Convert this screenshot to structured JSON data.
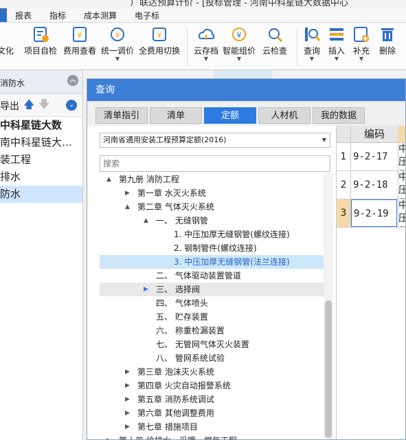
{
  "window": {
    "title": "广联达预算计价 - [投标管理 - 河南中科星链大数据中心"
  },
  "menu": {
    "items": [
      "报表",
      "指标",
      "成本测算",
      "电子标"
    ]
  },
  "ribbon": {
    "partial_label": "文化",
    "buttons": [
      {
        "label": "项目自检",
        "icon": "project-check-icon",
        "dropdown": false
      },
      {
        "label": "费用查看",
        "icon": "fee-view-icon",
        "dropdown": false
      },
      {
        "label": "统一调价",
        "icon": "unified-price-icon",
        "dropdown": true
      },
      {
        "label": "全费用切换",
        "icon": "full-fee-switch-icon",
        "dropdown": false
      },
      {
        "label": "云存档",
        "icon": "cloud-archive-icon",
        "dropdown": true
      },
      {
        "label": "智能组价",
        "icon": "smart-pricing-icon",
        "dropdown": true
      },
      {
        "label": "云检查",
        "icon": "cloud-check-icon",
        "dropdown": false
      },
      {
        "label": "查询",
        "icon": "query-icon",
        "dropdown": true
      },
      {
        "label": "插入",
        "icon": "insert-icon",
        "dropdown": true
      },
      {
        "label": "补充",
        "icon": "supplement-icon",
        "dropdown": true
      },
      {
        "label": "删除",
        "icon": "delete-icon",
        "dropdown": false
      }
    ]
  },
  "left_panel": {
    "header": "消防水",
    "export_label": "导出",
    "items": [
      {
        "label": "中科星链大数",
        "bold": true,
        "selected": false
      },
      {
        "label": "南中科星链大…",
        "bold": false,
        "selected": false
      },
      {
        "label": "装工程",
        "bold": false,
        "selected": false
      },
      {
        "label": "排水",
        "bold": false,
        "selected": false
      },
      {
        "label": "防水",
        "bold": false,
        "selected": true
      }
    ]
  },
  "dialog": {
    "title": "查询",
    "tabs": [
      {
        "label": "清单指引",
        "active": false
      },
      {
        "label": "清单",
        "active": false
      },
      {
        "label": "定额",
        "active": true
      },
      {
        "label": "人材机",
        "active": false
      },
      {
        "label": "我的数据",
        "active": false
      }
    ],
    "library_select": "河南省通用安装工程预算定额(2016)",
    "search_placeholder": "搜索",
    "tree": [
      {
        "label": "第九册  消防工程",
        "indent": 0,
        "toggle": "▲",
        "state": ""
      },
      {
        "label": "第一章  水灭火系统",
        "indent": 1,
        "toggle": "▶",
        "state": ""
      },
      {
        "label": "第二章  气体灭火系统",
        "indent": 1,
        "toggle": "▲",
        "state": ""
      },
      {
        "label": "一、  无缝钢管",
        "indent": 2,
        "toggle": "▲",
        "state": ""
      },
      {
        "label": "1.  中压加厚无缝钢管(螺纹连接)",
        "indent": 3,
        "toggle": "",
        "state": ""
      },
      {
        "label": "2.  钢制管件(螺纹连接)",
        "indent": 3,
        "toggle": "",
        "state": ""
      },
      {
        "label": "3.  中压加厚无缝钢管(法兰连接)",
        "indent": 3,
        "toggle": "",
        "state": "selected"
      },
      {
        "label": "二、  气体驱动装置管道",
        "indent": 2,
        "toggle": "",
        "state": ""
      },
      {
        "label": "三、  选择阀",
        "indent": 2,
        "toggle": "▶",
        "state": "hover"
      },
      {
        "label": "四、  气体喷头",
        "indent": 2,
        "toggle": "",
        "state": ""
      },
      {
        "label": "五、  贮存装置",
        "indent": 2,
        "toggle": "",
        "state": ""
      },
      {
        "label": "六、  称重检漏装置",
        "indent": 2,
        "toggle": "",
        "state": ""
      },
      {
        "label": "七、  无管网气体灭火装置",
        "indent": 2,
        "toggle": "",
        "state": ""
      },
      {
        "label": "八、  管网系统试验",
        "indent": 2,
        "toggle": "",
        "state": ""
      },
      {
        "label": "第三章  泡沫灭火系统",
        "indent": 1,
        "toggle": "▶",
        "state": ""
      },
      {
        "label": "第四章  火灾自动报警系统",
        "indent": 1,
        "toggle": "▶",
        "state": ""
      },
      {
        "label": "第五章  消防系统调试",
        "indent": 1,
        "toggle": "▶",
        "state": ""
      },
      {
        "label": "第六章  其他调整费用",
        "indent": 1,
        "toggle": "▶",
        "state": ""
      },
      {
        "label": "第七章  措施项目",
        "indent": 1,
        "toggle": "▶",
        "state": ""
      },
      {
        "label": "第十册  给排水、采暖、燃气工程",
        "indent": 0,
        "toggle": "▶",
        "state": ""
      }
    ],
    "table": {
      "header_code": "编码",
      "rows": [
        {
          "num": "1",
          "code": "9-2-17",
          "name": "中压称",
          "current": false
        },
        {
          "num": "2",
          "code": "9-2-18",
          "name": "中压称",
          "current": false
        },
        {
          "num": "3",
          "code": "9-2-19",
          "name": "中压称",
          "current": true
        }
      ]
    }
  }
}
